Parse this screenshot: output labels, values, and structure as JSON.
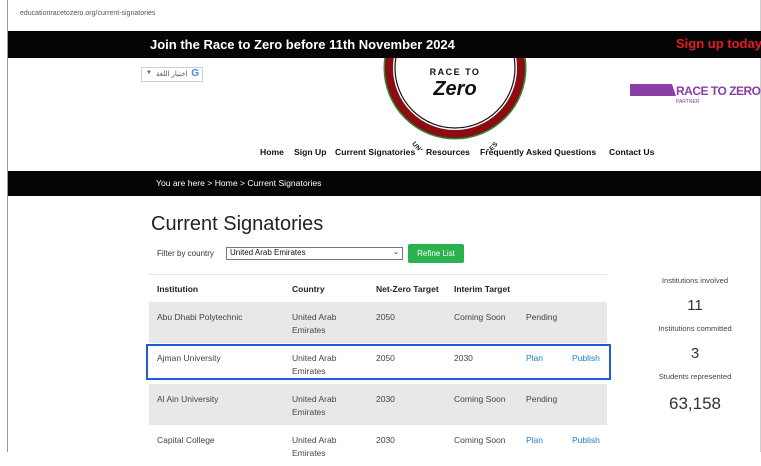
{
  "browser": {
    "url": "educationracetozero.org/current-signatories"
  },
  "banner": {
    "title": "Join the Race to Zero before 11th November 2024",
    "signup": "Sign up today"
  },
  "translate": {
    "label": "اختيار اللغة",
    "arrow": "▼"
  },
  "logo": {
    "top": "RACE TO",
    "main": "Zero",
    "arc": "UNIVERSITIES & COLLEGES"
  },
  "partner": {
    "title": "RACE TO ZERO",
    "sub": "PARTNER"
  },
  "nav": [
    "Home",
    "Sign Up",
    "Current Signatories",
    "Resources",
    "Frequently Asked Questions",
    "Contact Us"
  ],
  "breadcrumb": "You are here >  Home >  Current Signatories",
  "page_title": "Current Signatories",
  "filter": {
    "label": "Filter by country",
    "selected": "United Arab Emirates",
    "button": "Refine List"
  },
  "table": {
    "headers": [
      "Institution",
      "Country",
      "Net-Zero Target",
      "Interim Target"
    ],
    "rows": [
      {
        "institution": "Abu Dhabi Polytechnic",
        "country": "United Arab\nEmirates",
        "netzero": "2050",
        "interim": "Coming Soon",
        "status": "Pending",
        "plan": "",
        "publish": ""
      },
      {
        "institution": "Ajman University",
        "country": "United Arab\nEmirates",
        "netzero": "2050",
        "interim": "2030",
        "status": "",
        "plan": "Plan",
        "publish": "Publish"
      },
      {
        "institution": "Al Ain University",
        "country": "United Arab\nEmirates",
        "netzero": "2030",
        "interim": "Coming Soon",
        "status": "Pending",
        "plan": "",
        "publish": ""
      },
      {
        "institution": "Capital College",
        "country": "United Arab\nEmirates",
        "netzero": "2030",
        "interim": "Coming Soon",
        "status": "",
        "plan": "Plan",
        "publish": "Publish"
      }
    ]
  },
  "stats": {
    "involved_label": "Institutions involved",
    "involved": "11",
    "committed_label": "Institutions committed",
    "committed": "3",
    "students_label": "Students represented",
    "students": "63,158"
  },
  "colors": {
    "banner_bg": "#050505",
    "signup": "#e41b23",
    "refine": "#2bb24c",
    "link": "#1a7fd0",
    "highlight": "#1f5bd8",
    "logo_red": "#8b0d12",
    "logo_green": "#2f8a3a",
    "partner_purple": "#8a3fa8"
  }
}
